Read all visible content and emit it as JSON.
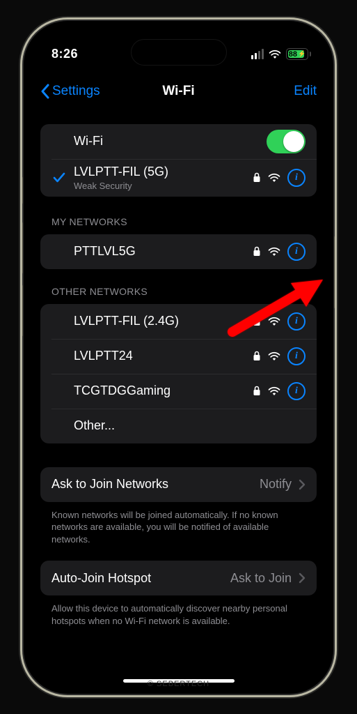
{
  "status": {
    "time": "8:26",
    "signal_bars_on": 2,
    "battery_pct": 88
  },
  "nav": {
    "back_label": "Settings",
    "title": "Wi-Fi",
    "edit_label": "Edit"
  },
  "wifi": {
    "toggle_label": "Wi-Fi",
    "toggle_on": true,
    "connected": {
      "ssid": "LVLPTT-FIL (5G)",
      "subtitle": "Weak Security"
    }
  },
  "sections": {
    "my_networks": {
      "header": "MY NETWORKS",
      "items": [
        {
          "ssid": "PTTLVL5G",
          "secured": true
        }
      ]
    },
    "other_networks": {
      "header": "OTHER NETWORKS",
      "items": [
        {
          "ssid": "LVLPTT-FIL (2.4G)",
          "secured": true
        },
        {
          "ssid": "LVLPTT24",
          "secured": true
        },
        {
          "ssid": "TCGTDGGaming",
          "secured": true
        }
      ],
      "other_label": "Other..."
    }
  },
  "ask_to_join": {
    "label": "Ask to Join Networks",
    "value": "Notify",
    "footer": "Known networks will be joined automatically. If no known networks are available, you will be notified of available networks."
  },
  "auto_join": {
    "label": "Auto-Join Hotspot",
    "value": "Ask to Join",
    "footer": "Allow this device to automatically discover nearby personal hotspots when no Wi-Fi network is available."
  },
  "watermark": "© SEBERTECH"
}
